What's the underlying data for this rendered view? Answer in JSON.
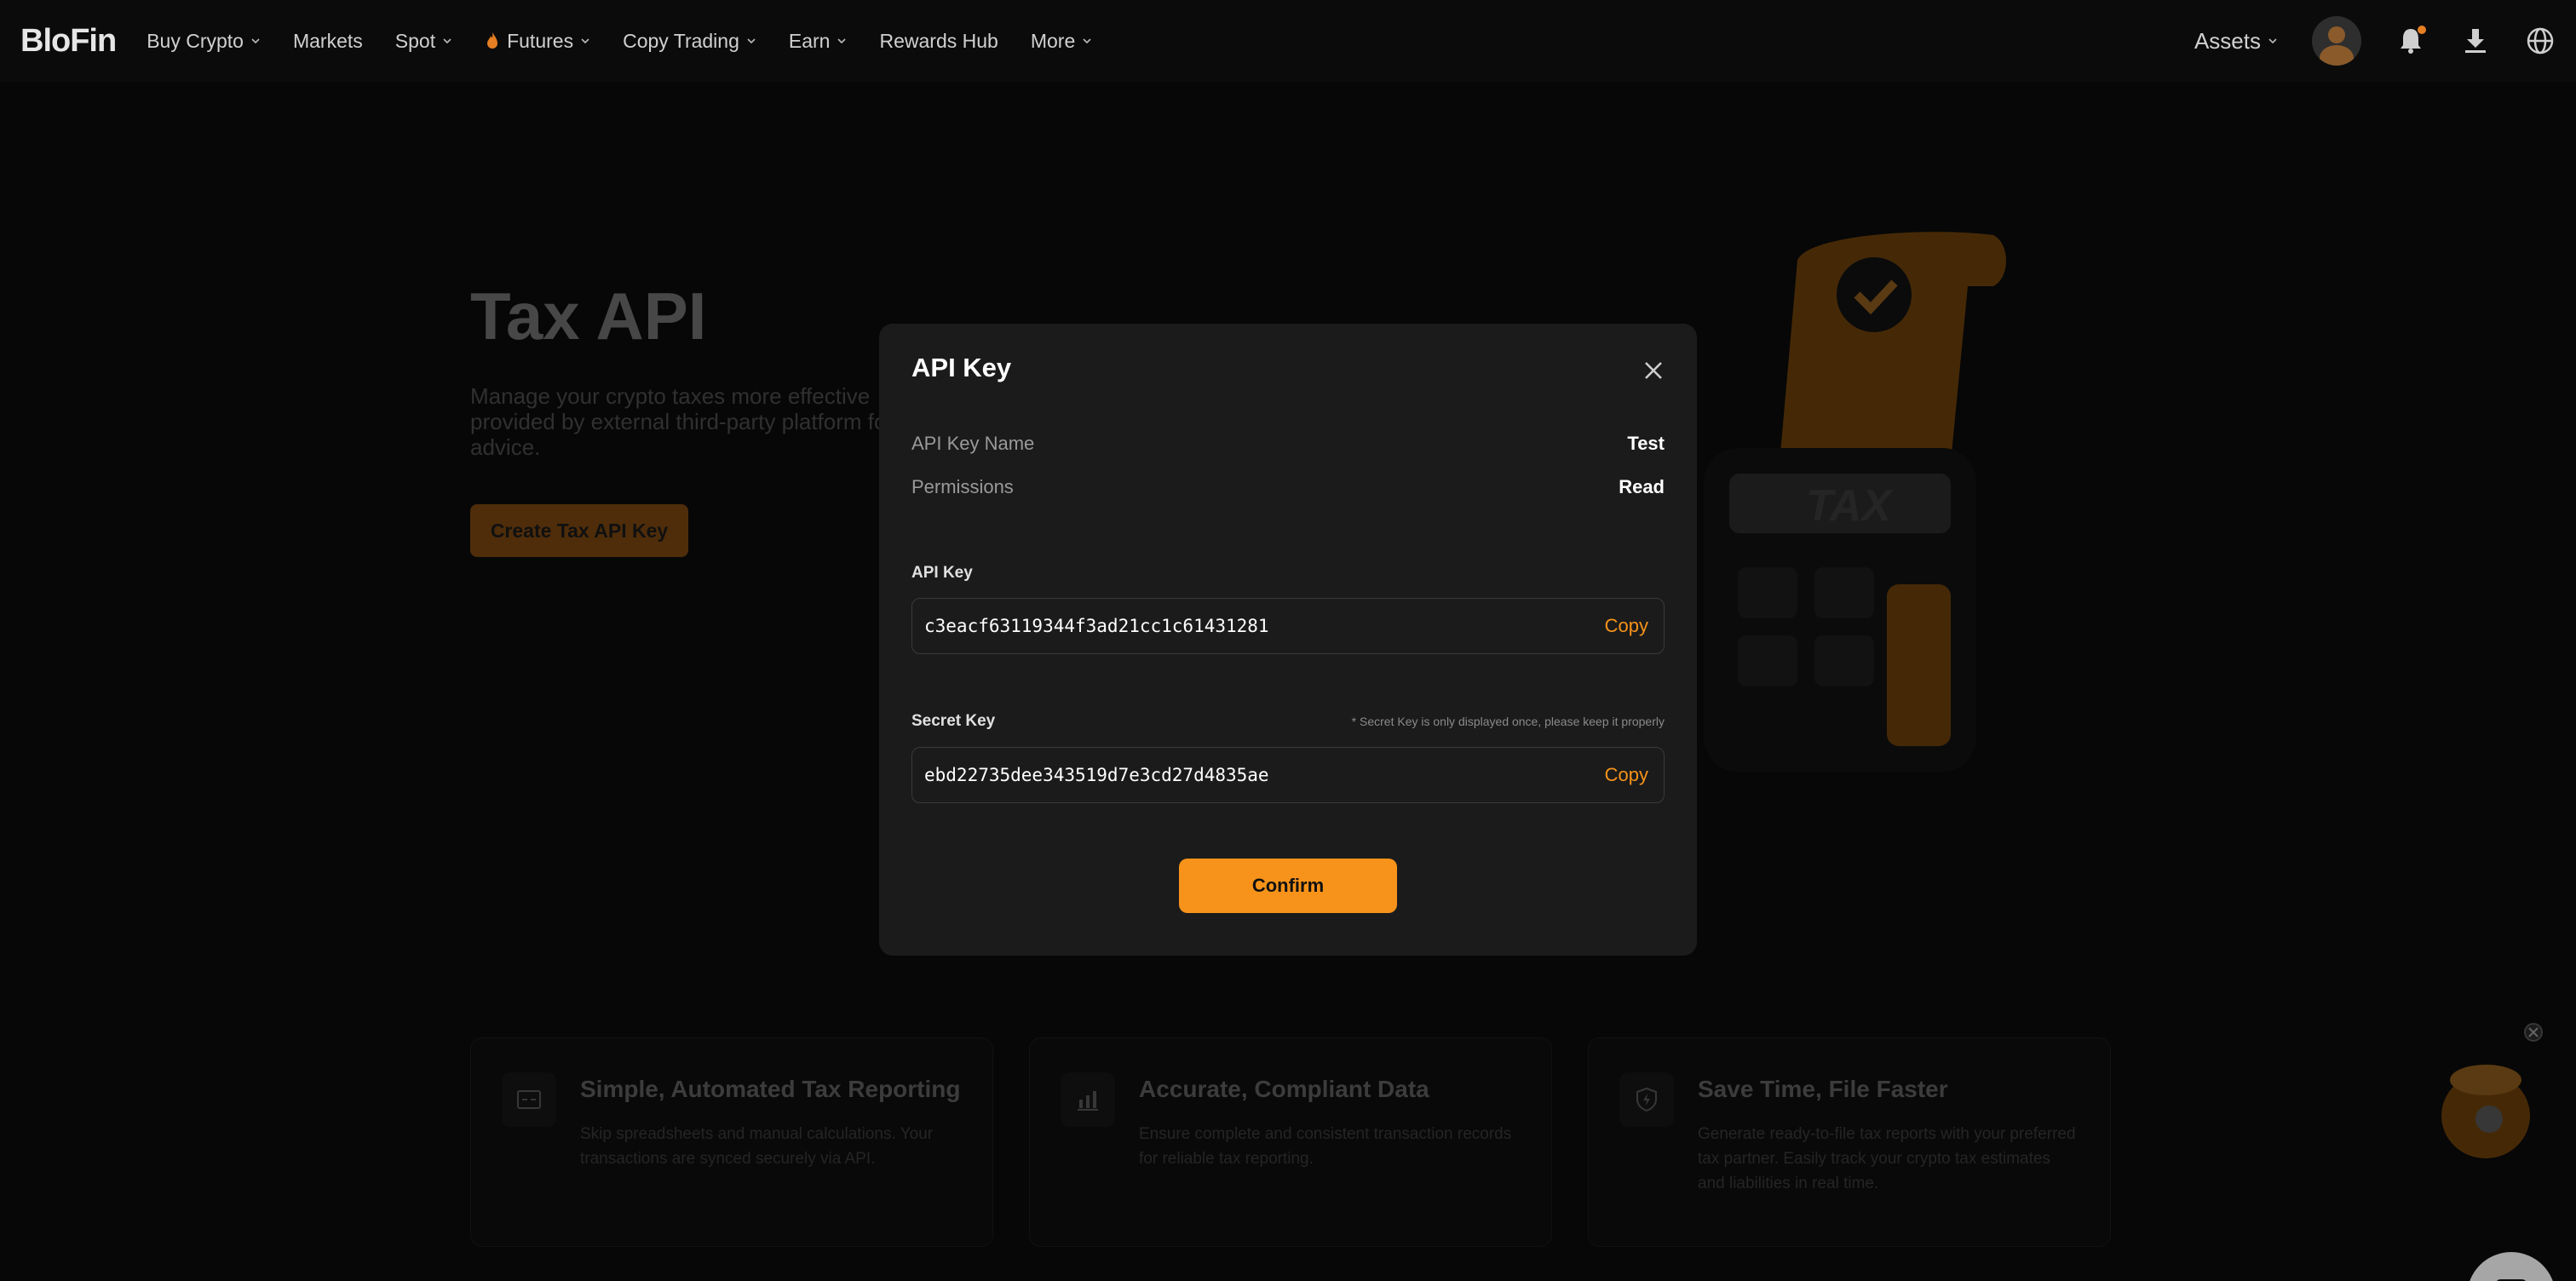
{
  "nav": {
    "logo": "BloFin",
    "items": [
      {
        "label": "Buy Crypto",
        "dropdown": true
      },
      {
        "label": "Markets",
        "dropdown": false
      },
      {
        "label": "Spot",
        "dropdown": true
      },
      {
        "label": "Futures",
        "dropdown": true
      },
      {
        "label": "Copy Trading",
        "dropdown": true
      },
      {
        "label": "Earn",
        "dropdown": true
      },
      {
        "label": "Rewards Hub",
        "dropdown": false
      },
      {
        "label": "More",
        "dropdown": true
      }
    ],
    "assets_label": "Assets"
  },
  "hero": {
    "title": "Tax API",
    "description": "Manage your crypto taxes more effective provided by external third-party platform for advice.",
    "create_button": "Create Tax API Key"
  },
  "features": [
    {
      "title": "Simple, Automated Tax Reporting",
      "desc": "Skip spreadsheets and manual calculations. Your transactions are synced securely via API."
    },
    {
      "title": "Accurate, Compliant Data",
      "desc": "Ensure complete and consistent transaction records for reliable tax reporting."
    },
    {
      "title": "Save Time, File Faster",
      "desc": "Generate ready-to-file tax reports with your preferred tax partner. Easily track your crypto tax estimates and liabilities in real time."
    }
  ],
  "modal": {
    "title": "API Key",
    "api_key_name_label": "API Key Name",
    "api_key_name_value": "Test",
    "permissions_label": "Permissions",
    "permissions_value": "Read",
    "api_key_label": "API Key",
    "api_key_value": "c3eacf63119344f3ad21cc1c61431281",
    "secret_key_label": "Secret Key",
    "secret_note": "* Secret Key is only displayed once, please keep it properly",
    "secret_key_value": "ebd22735dee343519d7e3cd27d4835ae",
    "copy_label": "Copy",
    "confirm_label": "Confirm"
  },
  "colors": {
    "accent": "#f7931a",
    "modal_bg": "#1b1b1b",
    "page_bg": "#0b0b0b"
  }
}
